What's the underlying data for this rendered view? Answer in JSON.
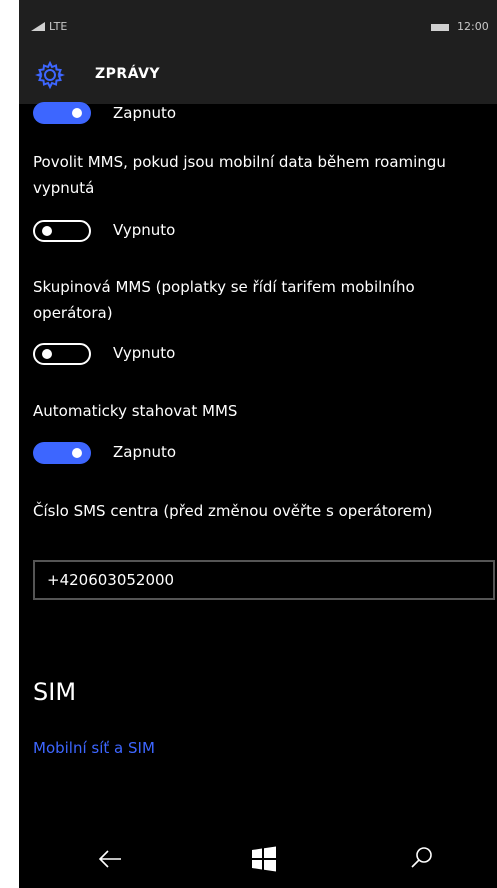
{
  "status_bar": {
    "network": "LTE",
    "time": "12:00"
  },
  "app_bar": {
    "title": "ZPRÁVY",
    "icon": "gear-icon"
  },
  "settings": {
    "top_toggle": {
      "state_label": "Zapnuto",
      "on": true
    },
    "roaming_mms": {
      "label": "Povolit MMS, pokud jsou mobilní data během roamingu vypnutá",
      "state_label": "Vypnuto",
      "on": false
    },
    "group_mms": {
      "label": "Skupinová MMS (poplatky se řídí tarifem mobilního operátora)",
      "state_label": "Vypnuto",
      "on": false
    },
    "auto_download_mms": {
      "label": "Automaticky stahovat MMS",
      "state_label": "Zapnuto",
      "on": true
    },
    "sms_center": {
      "label": "Číslo SMS centra (před změnou ověřte s operátorem)",
      "value": "+420603052000"
    }
  },
  "sim_section": {
    "heading": "SIM",
    "link": "Mobilní síť a SIM"
  },
  "colors": {
    "accent": "#3d66ff",
    "background": "#000000",
    "bar": "#1f1f1f",
    "carrier_mark": "#e20074"
  },
  "nav": {
    "icons": [
      "back-arrow-icon",
      "windows-start-icon",
      "search-icon"
    ]
  }
}
